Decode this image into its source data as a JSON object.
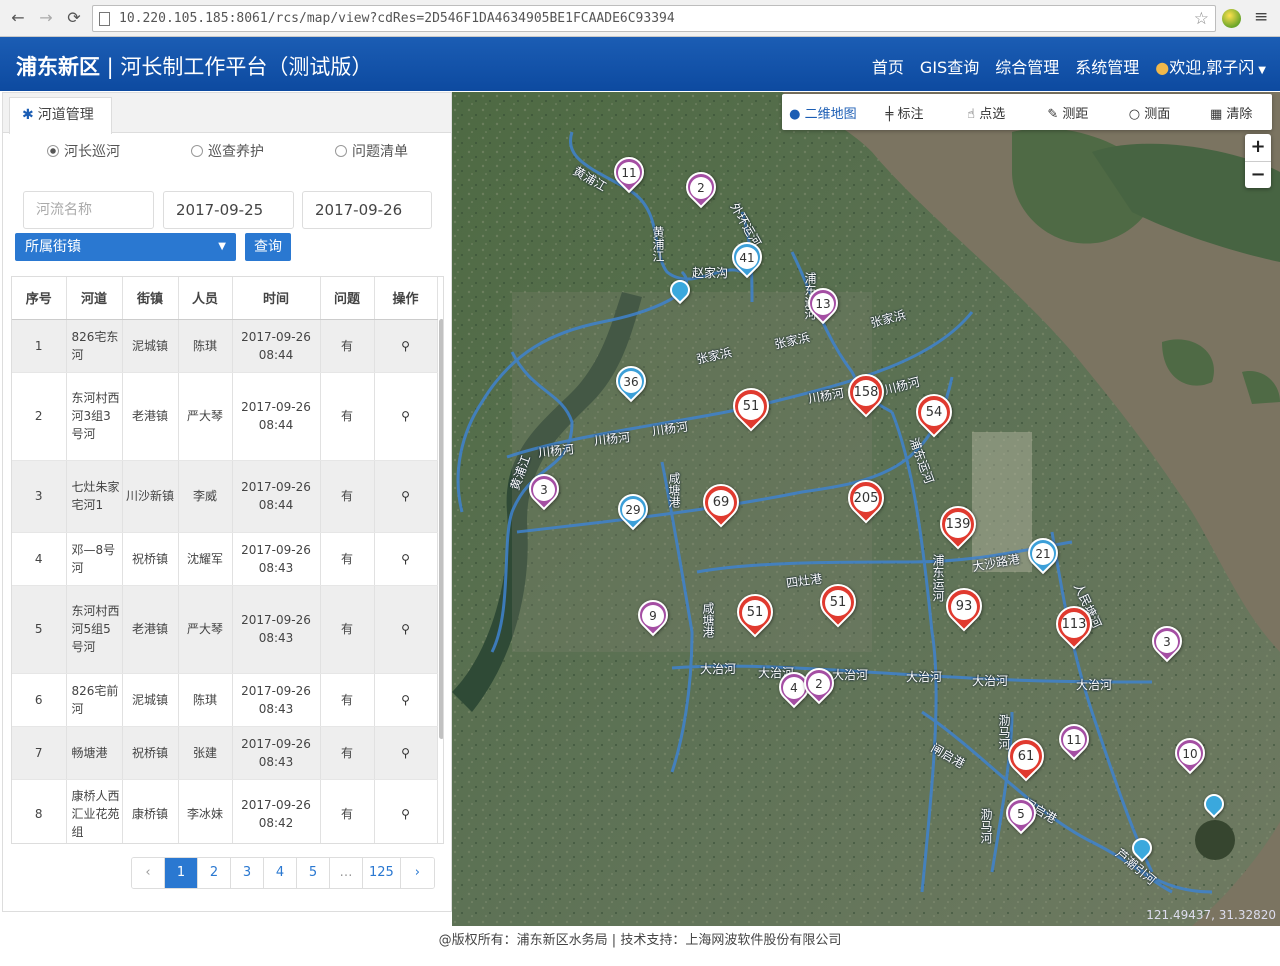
{
  "browser": {
    "url": "10.220.105.185:8061/rcs/map/view?cdRes=2D546F1DA4634905BE1FCAADE6C93394"
  },
  "header": {
    "brand_bold": "浦东新区",
    "brand_rest": " | 河长制工作平台（测试版）",
    "nav": [
      "首页",
      "GIS查询",
      "综合管理",
      "系统管理"
    ],
    "user": "欢迎,郭子闪"
  },
  "panel": {
    "tab": "河道管理",
    "radios": [
      "河长巡河",
      "巡查养护",
      "问题清单"
    ],
    "river_placeholder": "河流名称",
    "date_from": "2017-09-25",
    "date_to": "2017-09-26",
    "street_select": "所属街镇",
    "query_button": "查询",
    "columns": [
      "序号",
      "河道",
      "街镇",
      "人员",
      "时间",
      "问题",
      "操作"
    ],
    "rows": [
      {
        "no": "1",
        "river": "826宅东河",
        "town": "泥城镇",
        "person": "陈琪",
        "date": "2017-09-26",
        "time": "08:44",
        "issue": "有"
      },
      {
        "no": "2",
        "river": "东河村西河3组3号河",
        "town": "老港镇",
        "person": "严大琴",
        "date": "2017-09-26",
        "time": "08:44",
        "issue": "有"
      },
      {
        "no": "3",
        "river": "七灶朱家宅河1",
        "town": "川沙新镇",
        "person": "李威",
        "date": "2017-09-26",
        "time": "08:44",
        "issue": "有"
      },
      {
        "no": "4",
        "river": "邓—8号河",
        "town": "祝桥镇",
        "person": "沈耀军",
        "date": "2017-09-26",
        "time": "08:43",
        "issue": "有"
      },
      {
        "no": "5",
        "river": "东河村西河5组5号河",
        "town": "老港镇",
        "person": "严大琴",
        "date": "2017-09-26",
        "time": "08:43",
        "issue": "有"
      },
      {
        "no": "6",
        "river": "826宅前河",
        "town": "泥城镇",
        "person": "陈琪",
        "date": "2017-09-26",
        "time": "08:43",
        "issue": "有"
      },
      {
        "no": "7",
        "river": "畅塘港",
        "town": "祝桥镇",
        "person": "张建",
        "date": "2017-09-26",
        "time": "08:43",
        "issue": "有"
      },
      {
        "no": "8",
        "river": "康桥人西汇业花苑组",
        "town": "康桥镇",
        "person": "李冰妹",
        "date": "2017-09-26",
        "time": "08:42",
        "issue": "有"
      }
    ],
    "pager": [
      "‹",
      "1",
      "2",
      "3",
      "4",
      "5",
      "…",
      "125",
      "›"
    ],
    "pager_active": "1"
  },
  "map": {
    "toolbar": [
      "二维地图",
      "标注",
      "点选",
      "测距",
      "测面",
      "清除"
    ],
    "zoom_in": "+",
    "zoom_out": "−",
    "coords": "121.49437, 31.32820",
    "river_labels": [
      "黄浦江",
      "黄浦江",
      "赵家沟",
      "外环运河",
      "浦东运河",
      "张家浜",
      "张家浜",
      "张家浜",
      "川杨河",
      "川杨河",
      "川杨河",
      "川杨河",
      "川杨河",
      "咸塘港",
      "咸塘港",
      "浦东运河",
      "浦东运河",
      "大沙路港",
      "四灶港",
      "大治河",
      "大治河",
      "大治河",
      "大治河",
      "大治河",
      "大治河",
      "人民塘河",
      "闸启港",
      "闸启港",
      "泐马河",
      "泐马河",
      "芦潮引河",
      "黄浦江"
    ],
    "markers": [
      "11",
      "2",
      "41",
      "13",
      "36",
      "51",
      "158",
      "54",
      "3",
      "29",
      "69",
      "205",
      "139",
      "21",
      "9",
      "51",
      "51",
      "93",
      "113",
      "3",
      "4",
      "2",
      "61",
      "11",
      "10",
      "5"
    ],
    "marker_colors": {
      "red": "#e03a2f",
      "blue": "#3c9fd8",
      "purple": "#a44ea3"
    }
  },
  "footer": "@版权所有：浦东新区水务局 | 技术支持：上海网波软件股份有限公司"
}
